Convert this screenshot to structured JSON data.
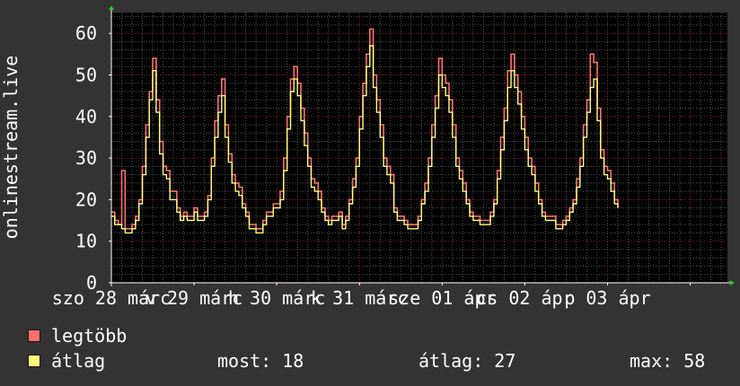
{
  "colors": {
    "background": "#333333",
    "plot_background": "#000000",
    "major_grid": "#8a2a2a",
    "minor_grid": "#555555",
    "axis": "#ffffff",
    "arrow": "#22cc22",
    "max_series": "#ff6f6f",
    "avg_series": "#ffff77"
  },
  "legend": [
    {
      "label": "legtöbb",
      "color": "#ff6f6f"
    },
    {
      "label": "átlag",
      "color": "#ffff77"
    }
  ],
  "stats": {
    "now": "most: 18",
    "avg": "átlag: 27",
    "max": "max: 58"
  },
  "chart_data": {
    "type": "line",
    "ylabel": "onlinestream.live",
    "ylim": [
      0,
      65
    ],
    "yticks": [
      0,
      10,
      20,
      30,
      40,
      50,
      60
    ],
    "xlim": [
      0,
      7.45
    ],
    "grid": true,
    "x_tick_labels": [
      "szo 28 márc",
      "v 29 márc",
      "h 30 márc",
      "k 31 márc",
      "sze 01 ápr",
      "cs 02 ápr",
      "p 03 ápr"
    ],
    "x_tick_positions": [
      0,
      1,
      2,
      3,
      4,
      5,
      6,
      7
    ],
    "day_hours": [
      0,
      1,
      2,
      3,
      4,
      5,
      6,
      7,
      8,
      9,
      10,
      11,
      12,
      13,
      14,
      15,
      16,
      17,
      18,
      19,
      20,
      21,
      22,
      23
    ],
    "series": [
      {
        "name": "legtöbb",
        "color": "#ff6f6f",
        "days": [
          [
            17,
            15,
            14,
            27,
            13,
            13,
            14,
            16,
            20,
            28,
            38,
            46,
            54,
            44,
            34,
            28,
            27,
            22,
            22,
            18,
            16,
            17,
            16,
            16
          ],
          [
            18,
            16,
            16,
            17,
            21,
            30,
            39,
            45,
            49,
            38,
            31,
            26,
            24,
            23,
            19,
            17,
            14,
            14,
            13,
            13,
            15,
            17,
            17,
            19
          ],
          [
            19,
            22,
            30,
            40,
            49,
            52,
            48,
            42,
            36,
            30,
            25,
            24,
            22,
            18,
            16,
            15,
            16,
            16,
            17,
            14,
            16,
            20,
            25,
            30
          ],
          [
            40,
            48,
            55,
            61,
            50,
            44,
            38,
            30,
            28,
            26,
            18,
            16,
            16,
            15,
            14,
            14,
            14,
            16,
            20,
            24,
            30,
            38,
            45,
            54
          ],
          [
            50,
            48,
            44,
            38,
            30,
            27,
            24,
            20,
            17,
            16,
            16,
            15,
            15,
            15,
            17,
            20,
            27,
            35,
            42,
            51,
            55,
            50,
            46,
            40
          ],
          [
            35,
            30,
            28,
            24,
            20,
            17,
            16,
            16,
            16,
            14,
            14,
            15,
            16,
            18,
            20,
            25,
            30,
            38,
            44,
            55,
            53,
            42,
            32,
            28
          ],
          [
            27,
            24,
            20,
            18
          ]
        ]
      },
      {
        "name": "átlag",
        "color": "#ffff77",
        "days": [
          [
            16,
            14,
            14,
            13,
            12,
            12,
            13,
            15,
            19,
            26,
            35,
            44,
            51,
            41,
            31,
            26,
            25,
            20,
            20,
            17,
            15,
            16,
            15,
            15
          ],
          [
            17,
            15,
            15,
            16,
            20,
            28,
            35,
            41,
            45,
            35,
            29,
            24,
            22,
            21,
            18,
            16,
            13,
            13,
            12,
            12,
            14,
            16,
            16,
            18
          ],
          [
            18,
            20,
            27,
            37,
            46,
            49,
            45,
            39,
            33,
            28,
            23,
            22,
            20,
            17,
            15,
            14,
            15,
            15,
            16,
            13,
            15,
            19,
            23,
            28
          ],
          [
            37,
            45,
            52,
            57,
            47,
            41,
            35,
            28,
            26,
            24,
            17,
            15,
            15,
            14,
            13,
            13,
            13,
            15,
            19,
            22,
            28,
            35,
            42,
            50
          ],
          [
            47,
            45,
            41,
            35,
            28,
            25,
            22,
            19,
            16,
            15,
            15,
            14,
            14,
            14,
            16,
            19,
            25,
            32,
            39,
            47,
            51,
            47,
            43,
            37
          ],
          [
            32,
            28,
            26,
            22,
            19,
            16,
            15,
            15,
            15,
            13,
            13,
            14,
            15,
            17,
            19,
            23,
            28,
            35,
            41,
            47,
            49,
            39,
            30,
            26
          ],
          [
            25,
            22,
            19,
            18
          ]
        ]
      }
    ]
  }
}
